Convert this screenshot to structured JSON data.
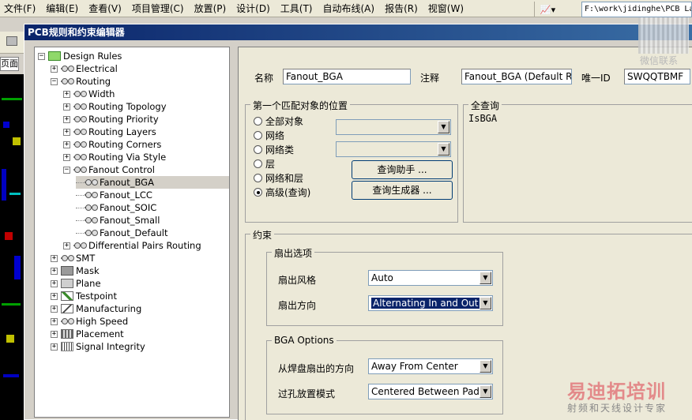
{
  "menubar": {
    "items": [
      "文件(F)",
      "编辑(E)",
      "查看(V)",
      "项目管理(C)",
      "放置(P)",
      "设计(D)",
      "工具(T)",
      "自动布线(A)",
      "报告(R)",
      "视窗(W)"
    ],
    "path": "F:\\work\\jidinghe\\PCB La"
  },
  "background_app": {
    "tab_label": "页面"
  },
  "dialog": {
    "title": "PCB规则和约束编辑器"
  },
  "tree": {
    "items": [
      {
        "label": "Design Rules",
        "level": 0,
        "expander": "−",
        "icon": "rules-root-icon"
      },
      {
        "label": "Electrical",
        "level": 1,
        "expander": "+",
        "icon": "electrical-icon"
      },
      {
        "label": "Routing",
        "level": 1,
        "expander": "−",
        "icon": "routing-icon"
      },
      {
        "label": "Width",
        "level": 2,
        "expander": "+",
        "icon": "rule-icon"
      },
      {
        "label": "Routing Topology",
        "level": 2,
        "expander": "+",
        "icon": "rule-icon"
      },
      {
        "label": "Routing Priority",
        "level": 2,
        "expander": "+",
        "icon": "rule-icon"
      },
      {
        "label": "Routing Layers",
        "level": 2,
        "expander": "+",
        "icon": "rule-icon"
      },
      {
        "label": "Routing Corners",
        "level": 2,
        "expander": "+",
        "icon": "rule-icon"
      },
      {
        "label": "Routing Via Style",
        "level": 2,
        "expander": "+",
        "icon": "rule-icon"
      },
      {
        "label": "Fanout Control",
        "level": 2,
        "expander": "−",
        "icon": "rule-icon"
      },
      {
        "label": "Fanout_BGA",
        "level": 3,
        "expander": "",
        "icon": "rule-icon",
        "selected": true
      },
      {
        "label": "Fanout_LCC",
        "level": 3,
        "expander": "",
        "icon": "rule-icon"
      },
      {
        "label": "Fanout_SOIC",
        "level": 3,
        "expander": "",
        "icon": "rule-icon"
      },
      {
        "label": "Fanout_Small",
        "level": 3,
        "expander": "",
        "icon": "rule-icon"
      },
      {
        "label": "Fanout_Default",
        "level": 3,
        "expander": "",
        "icon": "rule-icon"
      },
      {
        "label": "Differential Pairs Routing",
        "level": 2,
        "expander": "+",
        "icon": "rule-icon"
      },
      {
        "label": "SMT",
        "level": 1,
        "expander": "+",
        "icon": "smt-icon"
      },
      {
        "label": "Mask",
        "level": 1,
        "expander": "+",
        "icon": "mask-icon"
      },
      {
        "label": "Plane",
        "level": 1,
        "expander": "+",
        "icon": "plane-icon"
      },
      {
        "label": "Testpoint",
        "level": 1,
        "expander": "+",
        "icon": "testpoint-icon"
      },
      {
        "label": "Manufacturing",
        "level": 1,
        "expander": "+",
        "icon": "manufacturing-icon"
      },
      {
        "label": "High Speed",
        "level": 1,
        "expander": "+",
        "icon": "high-speed-icon"
      },
      {
        "label": "Placement",
        "level": 1,
        "expander": "+",
        "icon": "placement-icon"
      },
      {
        "label": "Signal Integrity",
        "level": 1,
        "expander": "+",
        "icon": "signal-integrity-icon"
      }
    ]
  },
  "rule": {
    "name_label": "名称",
    "name_value": "Fanout_BGA",
    "comment_label": "注释",
    "comment_value": "Fanout_BGA (Default Rule)",
    "id_label": "唯一ID",
    "id_value": "SWQQTBMF"
  },
  "match": {
    "title": "第一个匹配对象的位置",
    "options": [
      "全部对象",
      "网络",
      "网络类",
      "层",
      "网络和层",
      "高级(查询)"
    ],
    "selected_index": 5,
    "query_helper": "查询助手 ...",
    "query_builder": "查询生成器 ..."
  },
  "full_query": {
    "title": "全查询",
    "text": "IsBGA"
  },
  "constraints": {
    "title": "约束",
    "fanout_group": "扇出选项",
    "fanout_style_label": "扇出风格",
    "fanout_style_value": "Auto",
    "fanout_direction_label": "扇出方向",
    "fanout_direction_value": "Alternating In and Out",
    "bga_group": "BGA Options",
    "pad_direction_label": "从焊盘扇出的方向",
    "pad_direction_value": "Away From Center",
    "via_placement_label": "过孔放置模式",
    "via_placement_value": "Centered Between Pads"
  },
  "watermark": {
    "wechat": "微信联系",
    "brand": "易迪拓培训",
    "subtitle": "射频和天线设计专家"
  }
}
